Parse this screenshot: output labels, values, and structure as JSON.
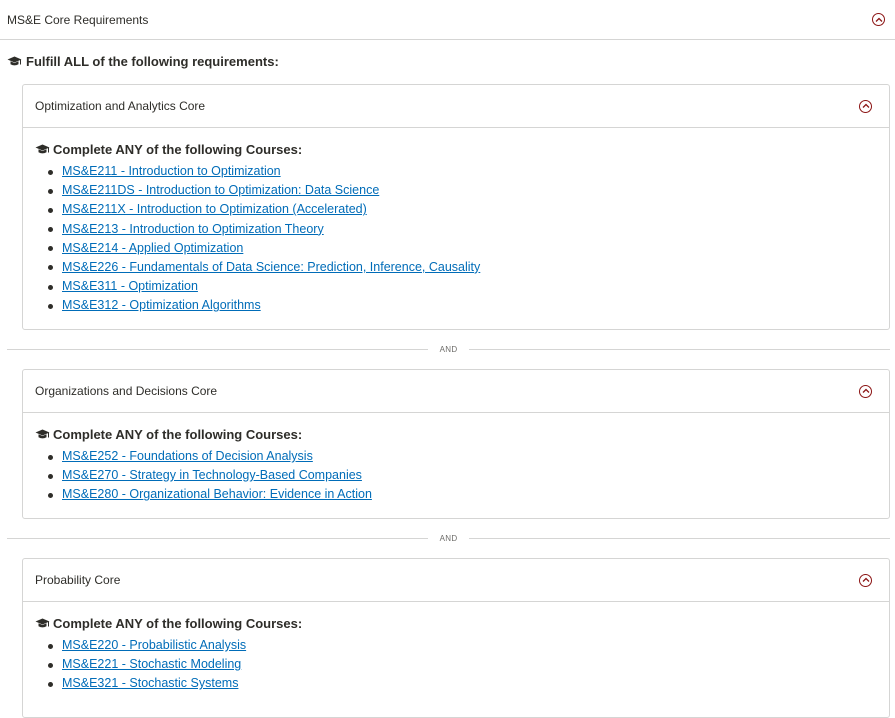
{
  "section": {
    "title": "MS&E Core Requirements"
  },
  "fulfill_text": "Fulfill ALL of the following requirements:",
  "separator_label": "AND",
  "blocks": [
    {
      "title": "Optimization and Analytics Core",
      "requirement": "Complete ANY of the following Courses:",
      "courses": [
        "MS&E211 - Introduction to Optimization",
        "MS&E211DS - Introduction to Optimization: Data Science",
        "MS&E211X - Introduction to Optimization (Accelerated)",
        "MS&E213 - Introduction to Optimization Theory",
        "MS&E214 - Applied Optimization",
        "MS&E226 - Fundamentals of Data Science: Prediction, Inference, Causality",
        "MS&E311 - Optimization",
        "MS&E312 - Optimization Algorithms"
      ]
    },
    {
      "title": "Organizations and Decisions Core",
      "requirement": "Complete ANY of the following Courses:",
      "courses": [
        "MS&E252 - Foundations of Decision Analysis",
        "MS&E270 - Strategy in Technology-Based Companies",
        "MS&E280 - Organizational Behavior: Evidence in Action"
      ]
    },
    {
      "title": "Probability Core",
      "requirement": "Complete ANY of the following Courses:",
      "courses": [
        "MS&E220 - Probabilistic Analysis",
        "MS&E221 - Stochastic Modeling",
        "MS&E321 - Stochastic Systems"
      ]
    }
  ],
  "colors": {
    "accent": "#8c1515",
    "link": "#006cb8",
    "border": "#d5d5d4",
    "text": "#2e2d29"
  },
  "icons": {
    "collapse": "chevron-up-circle-icon",
    "requirement": "graduation-cap-icon"
  }
}
